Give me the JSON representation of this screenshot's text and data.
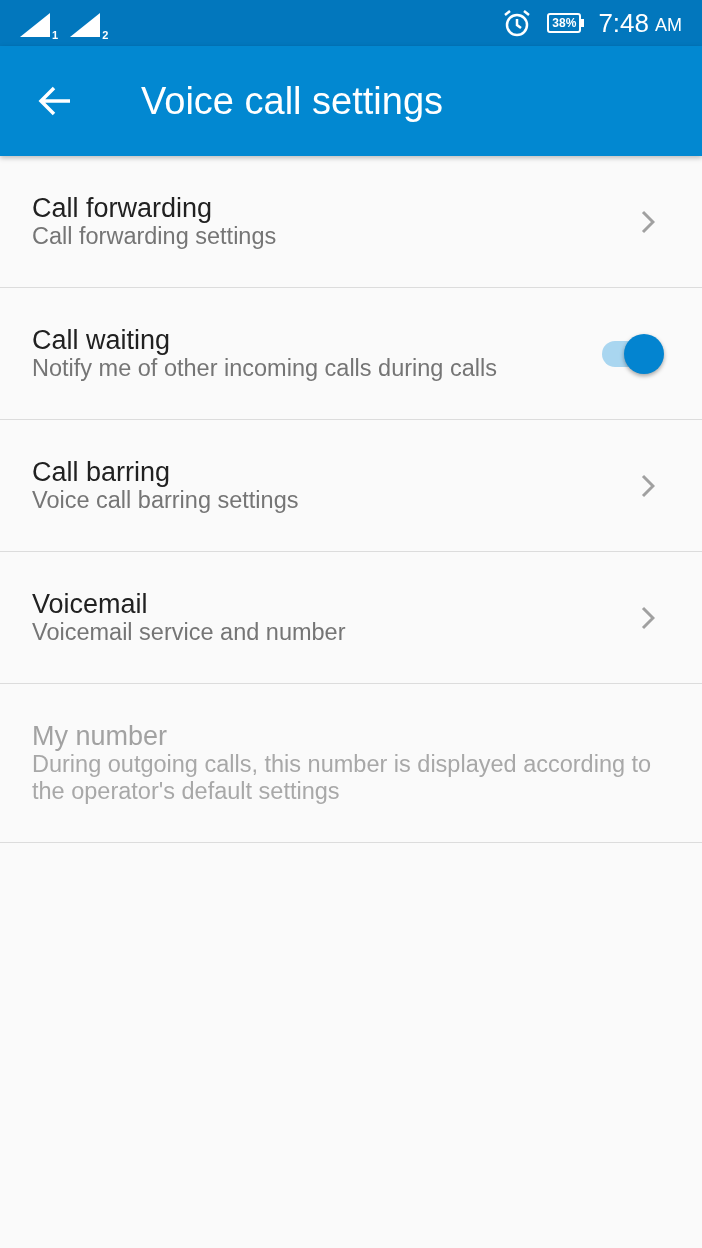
{
  "status_bar": {
    "sims": [
      {
        "label": "1"
      },
      {
        "label": "2"
      }
    ],
    "battery": "38%",
    "time": "7:48",
    "period": "AM"
  },
  "app_bar": {
    "title": "Voice call settings"
  },
  "settings": [
    {
      "kind": "link",
      "title": "Call forwarding",
      "subtitle": "Call forwarding settings",
      "disabled": false
    },
    {
      "kind": "toggle",
      "title": "Call waiting",
      "subtitle": "Notify me of other incoming calls during calls",
      "on": true,
      "disabled": false
    },
    {
      "kind": "link",
      "title": "Call barring",
      "subtitle": "Voice call barring settings",
      "disabled": false
    },
    {
      "kind": "link",
      "title": "Voicemail",
      "subtitle": "Voicemail service and number",
      "disabled": false
    },
    {
      "kind": "plain",
      "title": "My number",
      "subtitle": "During outgoing calls, this number is displayed according to the operator's default settings",
      "disabled": true
    }
  ]
}
